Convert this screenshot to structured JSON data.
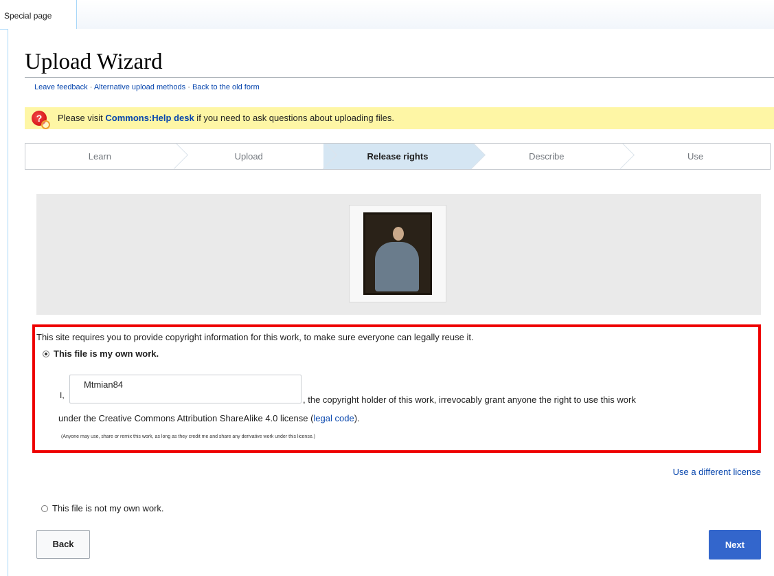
{
  "tabs": {
    "special_page": "Special page"
  },
  "page": {
    "title": "Upload Wizard"
  },
  "links": {
    "leave_feedback": "Leave feedback",
    "alternative_methods": "Alternative upload methods",
    "old_form": "Back to the old form",
    "separator": " · "
  },
  "notice": {
    "prefix": "Please visit ",
    "link": "Commons:Help desk",
    "suffix": " if you need to ask questions about uploading files."
  },
  "steps": [
    "Learn",
    "Upload",
    "Release rights",
    "Describe",
    "Use"
  ],
  "active_step": "Release rights",
  "license": {
    "requirement": "This site requires you to provide copyright information for this work, to make sure everyone can legally reuse it.",
    "own_work": "This file is my own work.",
    "i_label": "I,",
    "author_value": "Mtmian84",
    "grant_line1": ", the copyright holder of this work, irrevocably grant anyone the right to use this work",
    "grant_line2_prefix": "under the Creative Commons Attribution ShareAlike 4.0 license (",
    "legal_code": "legal code",
    "grant_line2_suffix": ").",
    "note": "(Anyone may use, share or remix this work, as long as they credit me and share any derivative work under this license.)",
    "different_license": "Use a different license",
    "not_own_work": "This file is not my own work."
  },
  "buttons": {
    "back": "Back",
    "next": "Next"
  },
  "colors": {
    "accent": "#3366cc",
    "highlight_border": "#ee0000",
    "notice_bg": "#fef6a5",
    "active_step_bg": "#d5e6f3"
  }
}
